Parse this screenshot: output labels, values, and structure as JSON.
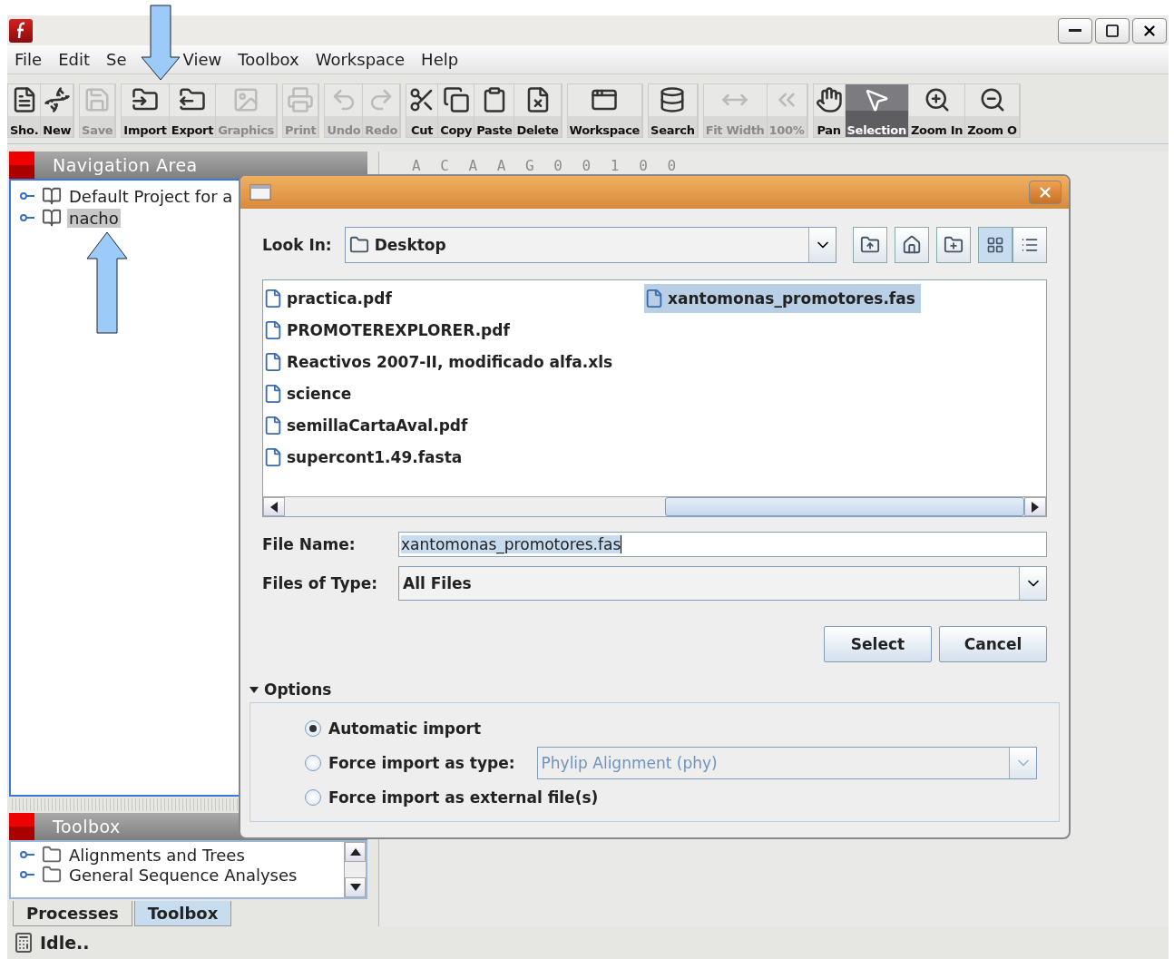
{
  "menu": [
    {
      "label": "File"
    },
    {
      "label": "Edit"
    },
    {
      "label": "Se"
    },
    {
      "label": "View"
    },
    {
      "label": "Toolbox"
    },
    {
      "label": "Workspace"
    },
    {
      "label": "Help"
    }
  ],
  "toolbar": [
    [
      {
        "label": "Sho.",
        "disabled": false,
        "selected": false
      },
      {
        "label": "New",
        "disabled": false,
        "selected": false
      }
    ],
    [
      {
        "label": "Save",
        "disabled": true,
        "selected": false
      }
    ],
    [
      {
        "label": "Import",
        "disabled": false,
        "selected": false
      },
      {
        "label": "Export",
        "disabled": false,
        "selected": false
      },
      {
        "label": "Graphics",
        "disabled": true,
        "selected": false
      }
    ],
    [
      {
        "label": "Print",
        "disabled": true,
        "selected": false
      }
    ],
    [
      {
        "label": "Undo",
        "disabled": true,
        "selected": false
      },
      {
        "label": "Redo",
        "disabled": true,
        "selected": false
      }
    ],
    [
      {
        "label": "Cut",
        "disabled": false,
        "selected": false
      },
      {
        "label": "Copy",
        "disabled": false,
        "selected": false
      },
      {
        "label": "Paste",
        "disabled": false,
        "selected": false
      },
      {
        "label": "Delete",
        "disabled": false,
        "selected": false
      }
    ],
    [
      {
        "label": "Workspace",
        "disabled": false,
        "selected": false
      }
    ],
    [
      {
        "label": "Search",
        "disabled": false,
        "selected": false
      }
    ],
    [
      {
        "label": "Fit Width",
        "disabled": true,
        "selected": false
      },
      {
        "label": "100%",
        "disabled": true,
        "selected": false
      }
    ],
    [
      {
        "label": "Pan",
        "disabled": false,
        "selected": false
      },
      {
        "label": "Selection",
        "disabled": false,
        "selected": true
      },
      {
        "label": "Zoom In",
        "disabled": false,
        "selected": false
      },
      {
        "label": "Zoom O",
        "disabled": false,
        "selected": false
      }
    ]
  ],
  "navigation": {
    "title": "Navigation Area",
    "items": [
      {
        "label": "Default Project for a",
        "selected": false
      },
      {
        "label": "nacho",
        "selected": true
      }
    ]
  },
  "sequence_ruler": "A C A A G 0 0 1 0 0",
  "toolbox": {
    "title": "Toolbox",
    "items": [
      {
        "label": "Alignments and Trees"
      },
      {
        "label": "General Sequence Analyses"
      }
    ],
    "tabs": [
      {
        "label": "Processes",
        "selected": false
      },
      {
        "label": "Toolbox",
        "selected": true
      }
    ]
  },
  "status_bar": "Idle..",
  "dialog": {
    "look_in_label": "Look In:",
    "look_in": "Desktop",
    "view_buttons": [
      {
        "selected": true
      },
      {
        "selected": false
      }
    ],
    "files": [
      {
        "name": "practica.pdf",
        "selected": false
      },
      {
        "name": "PROMOTEREXPLORER.pdf",
        "selected": false
      },
      {
        "name": "Reactivos 2007-II, modificado alfa.xls",
        "selected": false
      },
      {
        "name": "science",
        "selected": false
      },
      {
        "name": "semillaCartaAval.pdf",
        "selected": false
      },
      {
        "name": "supercont1.49.fasta",
        "selected": false
      },
      {
        "name": "xantomonas_promotores.fas",
        "selected": true
      }
    ],
    "file_name_label": "File Name:",
    "file_name": "xantomonas_promotores.fas",
    "file_type_label": "Files of Type:",
    "file_type": "All Files",
    "buttons": [
      "Select",
      "Cancel"
    ],
    "options": {
      "title": "Options",
      "expanded": true,
      "radios": [
        {
          "label": "Automatic import",
          "selected": true
        },
        {
          "label": "Force import as type:",
          "selected": false,
          "combo": "Phylip Alignment (phy)",
          "combo_disabled": true
        },
        {
          "label": "Force import as external file(s)",
          "selected": false
        }
      ]
    }
  }
}
